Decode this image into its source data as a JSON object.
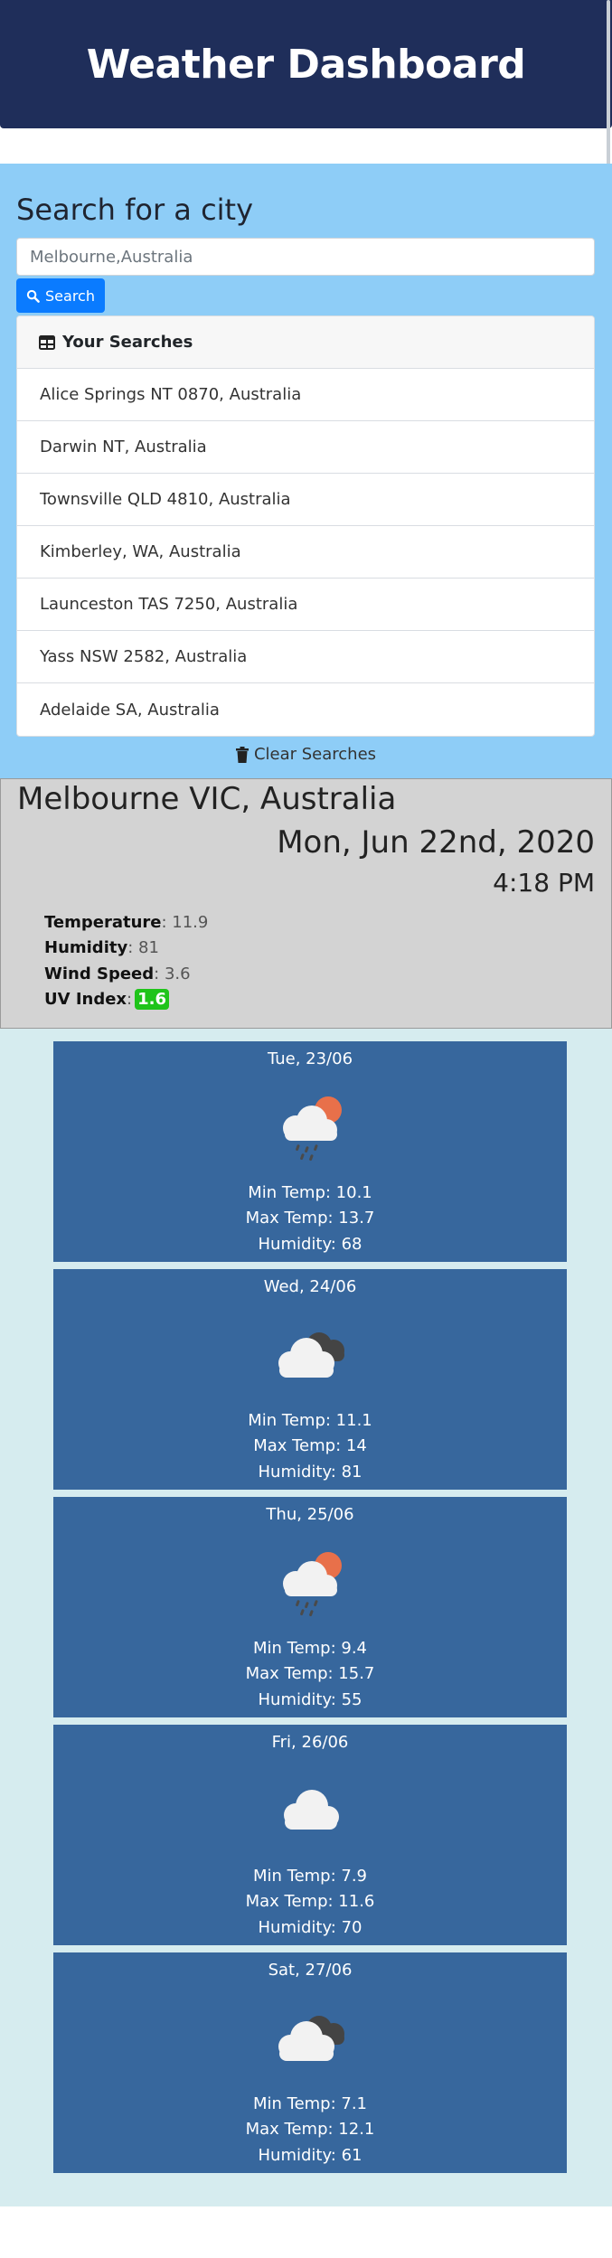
{
  "header": {
    "title": "Weather Dashboard"
  },
  "search": {
    "title": "Search for a city",
    "input_value": "Melbourne,Australia",
    "button_label": "Search",
    "history_title": "Your Searches",
    "history": [
      "Alice Springs NT 0870, Australia",
      "Darwin NT, Australia",
      "Townsville QLD 4810, Australia",
      "Kimberley, WA, Australia",
      "Launceston TAS 7250, Australia",
      "Yass NSW 2582, Australia",
      "Adelaide SA, Australia"
    ],
    "clear_label": "Clear Searches"
  },
  "current": {
    "city": "Melbourne VIC, Australia",
    "date": "Mon, Jun 22nd, 2020",
    "time": "4:18 PM",
    "temperature_label": "Temperature",
    "temperature": "11.9",
    "humidity_label": "Humidity",
    "humidity": "81",
    "wind_label": "Wind Speed",
    "wind": "3.6",
    "uv_label": "UV Index",
    "uv": "1.6",
    "uv_color": "#1fc41a"
  },
  "forecast": [
    {
      "date": "Tue, 23/06",
      "icon": "rain-sun-cloud-icon",
      "min": "Min Temp: 10.1",
      "max": "Max Temp: 13.7",
      "humidity": "Humidity: 68"
    },
    {
      "date": "Wed, 24/06",
      "icon": "dark-clouds-icon",
      "min": "Min Temp: 11.1",
      "max": "Max Temp: 14",
      "humidity": "Humidity: 81"
    },
    {
      "date": "Thu, 25/06",
      "icon": "rain-sun-cloud-icon",
      "min": "Min Temp: 9.4",
      "max": "Max Temp: 15.7",
      "humidity": "Humidity: 55"
    },
    {
      "date": "Fri, 26/06",
      "icon": "cloud-icon",
      "min": "Min Temp: 7.9",
      "max": "Max Temp: 11.6",
      "humidity": "Humidity: 70"
    },
    {
      "date": "Sat, 27/06",
      "icon": "dark-clouds-icon",
      "min": "Min Temp: 7.1",
      "max": "Max Temp: 12.1",
      "humidity": "Humidity: 61"
    }
  ],
  "colors": {
    "header_bg": "#1f2e5a",
    "search_bg": "#8ecdf7",
    "button_bg": "#0a7bff",
    "current_bg": "#d3d3d3",
    "forecast_bg": "#d6ecef",
    "forecast_card_bg": "#37679d"
  }
}
